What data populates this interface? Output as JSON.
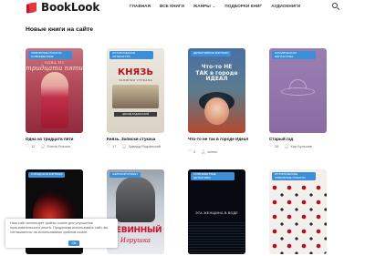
{
  "header": {
    "logo_text": "BookLook",
    "nav": [
      {
        "label": "ГЛАВНАЯ"
      },
      {
        "label": "ВСЕ КНИГИ"
      },
      {
        "label": "ЖАНРЫ"
      },
      {
        "label": "ПОДБОРКИ КНИГ"
      },
      {
        "label": "АУДИОКНИГИ"
      }
    ]
  },
  "section": {
    "title": "Новые книги на сайте"
  },
  "books": [
    {
      "badge": "ЛЮБОВНЫЕ РОМАНЫ СОВРЕМЕННЫЕ",
      "cover_top": "ОДНА ИЗ",
      "cover_main": "тридцати пяти",
      "title": "Одна из тридцати пяти",
      "likes": "12",
      "author": "Елена Рохина"
    },
    {
      "badge": "ИСТОРИЧЕСКАЯ ЛИТЕРАТУРА",
      "cover_main": "КНЯЗЬ",
      "cover_sub": "ЗАПИСКИ СТУКАЧА",
      "cover_bar": "ЭДУАРД РАДЗИНСКИЙ",
      "title": "Князь. Записки стукача",
      "likes": "17",
      "author": "Эдвард Радзинский"
    },
    {
      "badge": "ДЕТЕКТИВНОЕ ФЭНТЕЗИ",
      "cover_main": "Что-то НЕ ТАК в городе ИДЕАЛ",
      "title": "Что-то не так в городе Идеал",
      "likes": "4",
      "author": "admin"
    },
    {
      "badge": "КОСМИЧЕСКАЯ ФАНТАСТИКА",
      "title": "Старый гад",
      "likes": "26",
      "author": "Кир Булычев"
    },
    {
      "badge": "ГОРОДСКОЕ ФЭНТЕЗИ"
    },
    {
      "badge": "ЖЕНСКИЙ РОМАН",
      "cover_main": "НЕВИННЫЙ",
      "cover_sub": "Игрушка"
    },
    {
      "badge": "СОВРЕМЕННЫЕ ДЕТЕКТИВЫ",
      "cover_main": "ЭТА ЖЕНЩИНА В ВОДЕ"
    },
    {
      "badge": "ИСТОРИЧЕСКИЕ ЛЮБОВНЫЕ РОМАНЫ"
    }
  ],
  "cookie": {
    "text": "Наш сайт использует файлы cookie для улучшения пользовательского опыта. Продолжая использовать сайт, вы соглашаетесь на использование файлов cookie.",
    "button": "Ok"
  },
  "colors": {
    "badge": "#3b8fd9",
    "logo": "#c8102e"
  }
}
